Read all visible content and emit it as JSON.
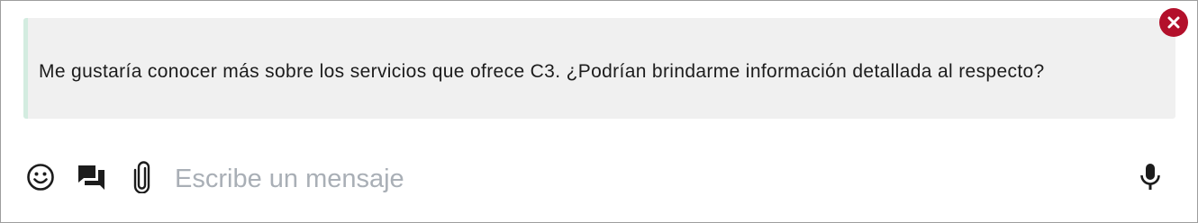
{
  "reply_preview": {
    "text": "Me gustaría conocer más sobre los servicios que ofrece C3. ¿Podrían brindarme información detallada al respecto?",
    "close_icon": "close-circle-icon",
    "accent_color": "#b3102b",
    "bar_color": "#d3ece0"
  },
  "composer": {
    "emoji_icon": "emoji-icon",
    "quick_replies_icon": "chat-bubbles-icon",
    "attach_icon": "paperclip-icon",
    "placeholder": "Escribe un mensaje",
    "value": "",
    "mic_icon": "microphone-icon"
  }
}
